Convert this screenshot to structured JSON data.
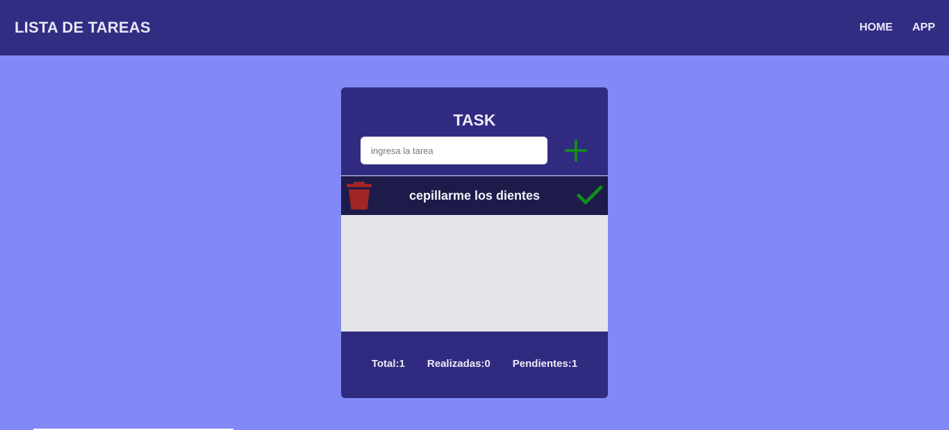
{
  "navbar": {
    "brand": "LISTA DE TAREAS",
    "links": [
      "HOME",
      "APP"
    ]
  },
  "card": {
    "title": "TASK",
    "input": {
      "placeholder": "ingresa la tarea",
      "value": ""
    },
    "add_icon": "plus-icon",
    "tasks": [
      {
        "text": "cepillarme los dientes",
        "delete_icon": "trash-icon",
        "complete_icon": "check-icon"
      }
    ],
    "stats": {
      "total_label": "Total:",
      "total_value": "1",
      "done_label": "Realizadas:",
      "done_value": "0",
      "pending_label": "Pendientes:",
      "pending_value": "1"
    }
  },
  "colors": {
    "page_background": "#8289f6",
    "navbar": "#312d82",
    "card": "#302b80",
    "task_row": "#1d1b4a",
    "list_background": "#e4e5e9",
    "add_accent": "#138a1e",
    "delete_accent": "#a02525"
  }
}
